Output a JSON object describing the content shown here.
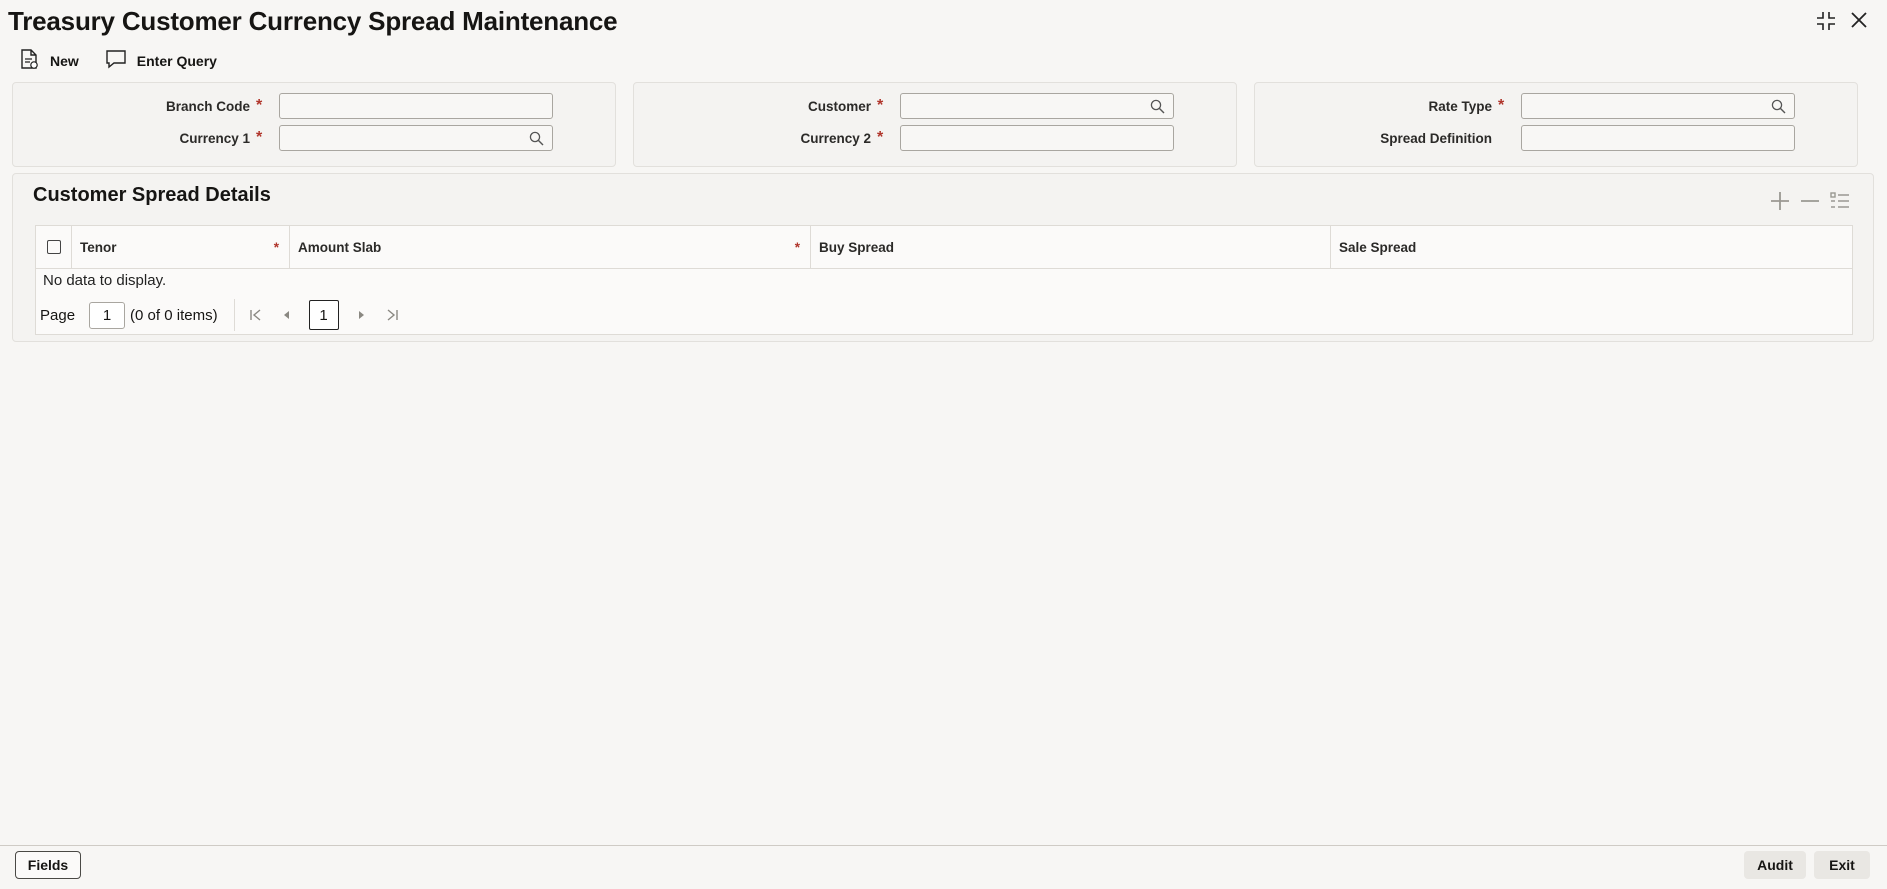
{
  "title": "Treasury Customer Currency Spread Maintenance",
  "toolbar": {
    "new_label": "New",
    "enter_query_label": "Enter Query"
  },
  "form": {
    "branch_code": {
      "label": "Branch Code",
      "required": "*",
      "value": ""
    },
    "currency1": {
      "label": "Currency 1",
      "required": "*",
      "value": ""
    },
    "customer": {
      "label": "Customer",
      "required": "*",
      "value": ""
    },
    "currency2": {
      "label": "Currency 2",
      "required": "*",
      "value": ""
    },
    "rate_type": {
      "label": "Rate Type",
      "required": "*",
      "value": ""
    },
    "spread_definition": {
      "label": "Spread Definition",
      "value": ""
    }
  },
  "details": {
    "title": "Customer Spread Details",
    "columns": [
      {
        "label": "Tenor",
        "required": "*"
      },
      {
        "label": "Amount Slab",
        "required": "*"
      },
      {
        "label": "Buy Spread",
        "required": ""
      },
      {
        "label": "Sale Spread",
        "required": ""
      }
    ],
    "no_data": "No data to display.",
    "pager": {
      "page_label": "Page",
      "page_value": "1",
      "items_text": "(0 of 0 items)",
      "current_page": "1"
    }
  },
  "footer": {
    "fields_label": "Fields",
    "audit_label": "Audit",
    "exit_label": "Exit"
  }
}
